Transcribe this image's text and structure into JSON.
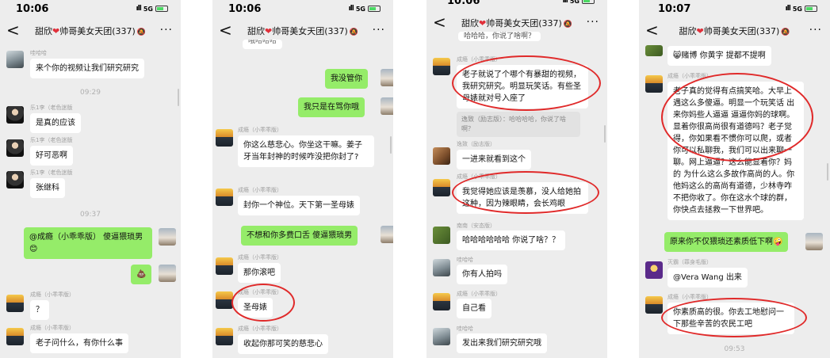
{
  "group_title": "甜欣❤️帅哥美女天团(337)",
  "group_title_left": "甜欣",
  "group_title_right": "帅哥美女天团(337)",
  "heart": "❤",
  "mute_icon": "🔕",
  "back_icon": "<",
  "more_icon": "···",
  "signal": "5G",
  "panels": [
    {
      "time": "10:06",
      "items": {
        "s1": "哇哈哈",
        "b1": "来个你的视频让我们研究研究",
        "t1": "09:29",
        "s2": "乐1李（老色迷版",
        "b2": "是真的应该",
        "s3": "乐1李（老色迷版",
        "b3": "好可恶啊",
        "s4": "乐1李（老色迷版",
        "b4": "张继科",
        "t2": "09:37",
        "b5": "@成瘾（小乖乖版） 傻逼猥琐男",
        "b5e": "😊",
        "b6": "💩",
        "s7": "成瘾（小乖乖版）",
        "b7": "？",
        "s8": "成瘾（小乖乖版）",
        "b8": "老子问什么，有你什么事"
      }
    },
    {
      "time": "10:06",
      "items": {
        "top": "哦哈哈哈",
        "b1": "我没管你",
        "b2": "我只是在骂你哦",
        "s3": "成瘾（小乖乖版）",
        "b3": "你这么慈悲心。你坐这干嘛。姜子牙当年封神的时候咋没把你封了?",
        "s4": "成瘾（小乖乖版）",
        "b4": "封你一个神位。天下第一圣母婊",
        "b5": "不想和你多费口舌 傻逼猥琐男",
        "s6": "成瘾（小乖乖版）",
        "b6": "那你滚吧",
        "s7": "成瘾（小乖乖版）",
        "b7": "圣母婊",
        "s8": "成瘾（小乖乖版）",
        "b8": "收起你那可笑的慈悲心"
      }
    },
    {
      "time": "10:06",
      "items": {
        "top": "哈哈哈，你说了啥啊？",
        "s1": "成瘾（小乖乖版）",
        "b1": "老子就说了个哪个有暴甜的视频，我研究研究。明显玩笑话。有些圣母婊就对号入座了",
        "q1": "逸致（励志版）：哈哈哈哈，你说了啥啊？",
        "s2": "逸致（励志版）",
        "b2": "一进来就看到这个",
        "s3": "成瘾（小乖乖版）",
        "b3": "我觉得她应该是羡慕，没人给她拍这种，因为辣眼睛，会长鸡眼",
        "s4": "南南（安态版）",
        "b4": "哈哈哈哈哈哈 你说了啥？？",
        "s5": "哇哈哈",
        "b5": "你有人拍吗",
        "s6": "成瘾（小乖乖版）",
        "b6": "自己看",
        "s7": "哇哈哈",
        "b7": "发出来我们研究研究哦"
      }
    },
    {
      "time": "10:07",
      "items": {
        "top": "😸赌博 你黄字 提都不提啊",
        "s1": "成瘾（小乖乖版）",
        "b1": "老子真的觉得有点搞笑哈。大早上遇这么多傻逼。明显一个玩笑话 出来你妈些人逼逼 逼逼你妈的球啊。显着你很高尚很有道德吗？老子觉得，你如果看不惯你可以爬，或者你可以私聊我，我们可以出来聊一聊。网上逼逼？这么能显着你？妈的 为什么这么多故作高尚的人。你他妈这么的高尚有道德，少林寺咋不把你收了。你在这水个球的群，你快点去拯救一下世界吧。",
        "b2": "原来你不仅猥琐还素质低下啊",
        "b2e": "🤪",
        "s3": "灭霸（罪身毛版）",
        "b3": "@Vera Wang 出来",
        "s4": "成瘾（小乖乖版）",
        "b4": "你素质高的很。你去工地慰问一下那些辛苦的农民工吧",
        "t1": "09:53"
      }
    }
  ]
}
